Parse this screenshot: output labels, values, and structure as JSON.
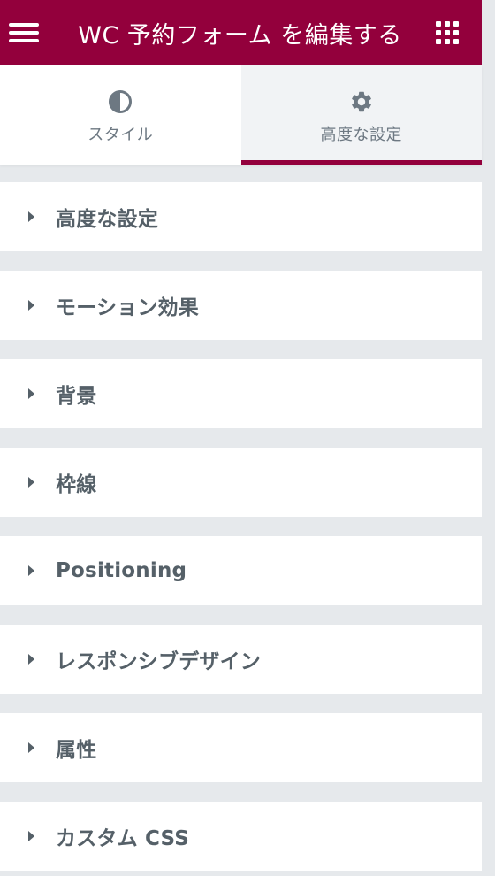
{
  "header": {
    "title": "WC 予約フォーム を編集する",
    "menu_icon": "hamburger-icon",
    "apps_icon": "grid-icon"
  },
  "tabs": [
    {
      "label": "スタイル",
      "icon": "contrast-icon",
      "active": false
    },
    {
      "label": "高度な設定",
      "icon": "gear-icon",
      "active": true
    }
  ],
  "sections": [
    {
      "label": "高度な設定"
    },
    {
      "label": "モーション効果"
    },
    {
      "label": "背景"
    },
    {
      "label": "枠線"
    },
    {
      "label": "Positioning"
    },
    {
      "label": "レスポンシブデザイン"
    },
    {
      "label": "属性"
    },
    {
      "label": "カスタム CSS"
    }
  ],
  "colors": {
    "brand": "#93003c",
    "text": "#556068",
    "tab_text": "#6d7882",
    "panel_bg": "#e6e9ec"
  }
}
